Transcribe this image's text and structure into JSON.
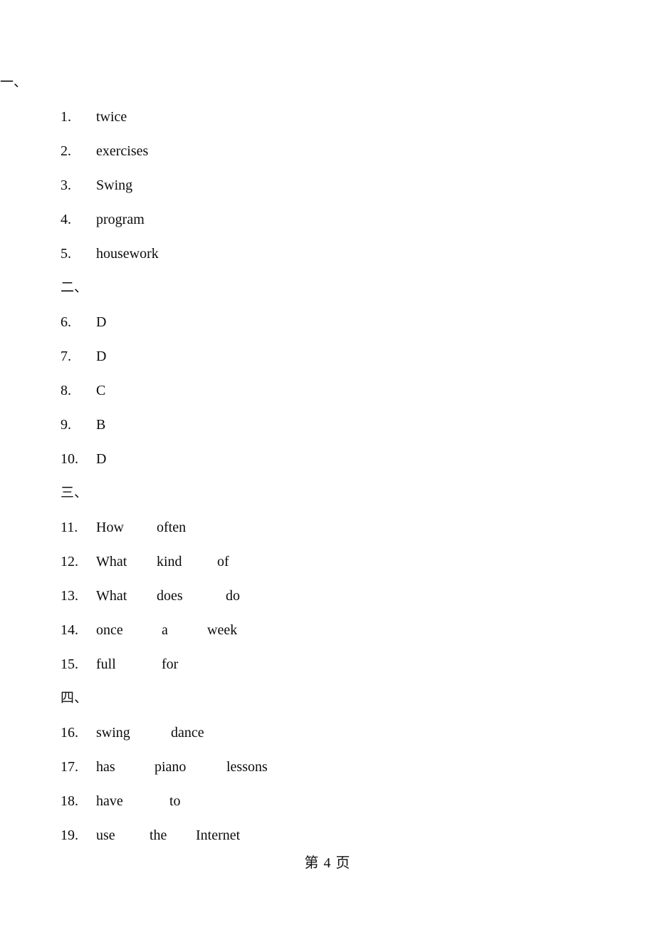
{
  "page": {
    "background_color": "#ffffff",
    "text_color": "#000000",
    "footer": "第 4 页"
  },
  "sections": [
    {
      "heading": "一、",
      "items": [
        {
          "number": "1.",
          "cells": [
            "twice"
          ]
        },
        {
          "number": "2.",
          "cells": [
            "exercises"
          ]
        },
        {
          "number": "3.",
          "cells": [
            "Swing"
          ]
        },
        {
          "number": "4.",
          "cells": [
            "program"
          ]
        },
        {
          "number": "5.",
          "cells": [
            "housework"
          ]
        }
      ]
    },
    {
      "heading": "二、",
      "items": [
        {
          "number": "6.",
          "cells": [
            "D"
          ]
        },
        {
          "number": "7.",
          "cells": [
            "D"
          ]
        },
        {
          "number": "8.",
          "cells": [
            "C"
          ]
        },
        {
          "number": "9.",
          "cells": [
            "B"
          ]
        },
        {
          "number": "10.",
          "cells": [
            "D"
          ]
        }
      ]
    },
    {
      "heading": "三、",
      "items": [
        {
          "number": "11.",
          "cells": [
            "How",
            "often"
          ]
        },
        {
          "number": "12.",
          "cells": [
            "What",
            "kind",
            "of"
          ]
        },
        {
          "number": "13.",
          "cells": [
            "What",
            "does",
            "do"
          ]
        },
        {
          "number": "14.",
          "cells": [
            "once",
            "a",
            "week"
          ]
        },
        {
          "number": "15.",
          "cells": [
            "full",
            "for"
          ]
        }
      ]
    },
    {
      "heading": "四、",
      "items": [
        {
          "number": "16.",
          "cells": [
            "swing",
            "dance"
          ]
        },
        {
          "number": "17.",
          "cells": [
            "has",
            "piano",
            "lessons"
          ]
        },
        {
          "number": "18.",
          "cells": [
            "have",
            "to"
          ]
        },
        {
          "number": "19.",
          "cells": [
            "use",
            "the",
            "Internet"
          ]
        }
      ]
    }
  ]
}
